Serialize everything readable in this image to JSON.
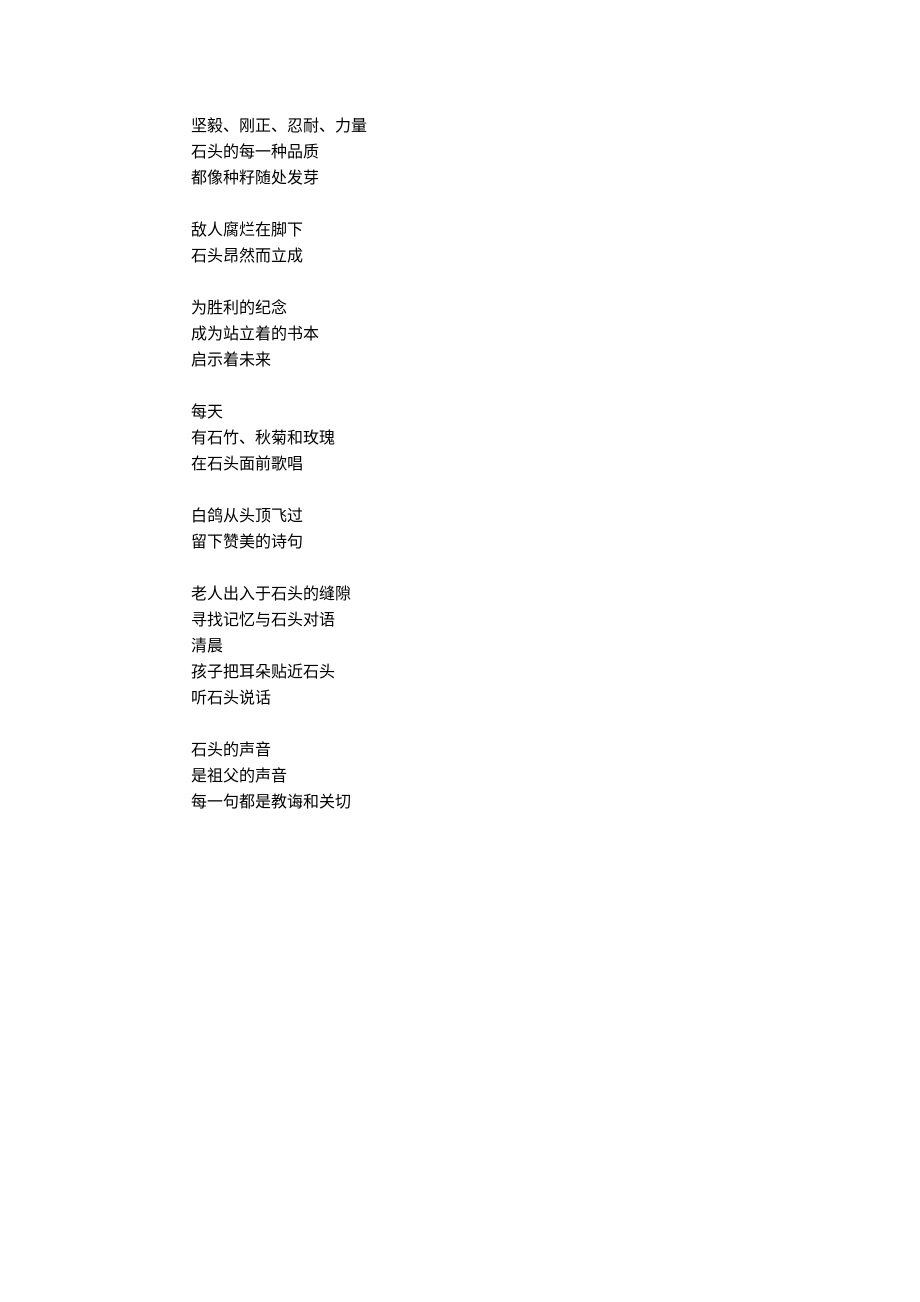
{
  "poem": {
    "stanzas": [
      {
        "lines": [
          "坚毅、刚正、忍耐、力量",
          "石头的每一种品质",
          "都像种籽随处发芽"
        ]
      },
      {
        "lines": [
          "敌人腐烂在脚下",
          "石头昂然而立成"
        ]
      },
      {
        "lines": [
          "为胜利的纪念",
          "成为站立着的书本",
          "启示着未来"
        ]
      },
      {
        "lines": [
          "每天",
          "有石竹、秋菊和玫瑰",
          "在石头面前歌唱"
        ]
      },
      {
        "lines": [
          "白鸽从头顶飞过",
          "留下赞美的诗句"
        ]
      },
      {
        "lines": [
          "老人出入于石头的缝隙",
          "寻找记忆与石头对语",
          "清晨",
          "孩子把耳朵贴近石头",
          "听石头说话"
        ]
      },
      {
        "lines": [
          "石头的声音",
          "是祖父的声音",
          "每一句都是教诲和关切"
        ]
      }
    ]
  }
}
